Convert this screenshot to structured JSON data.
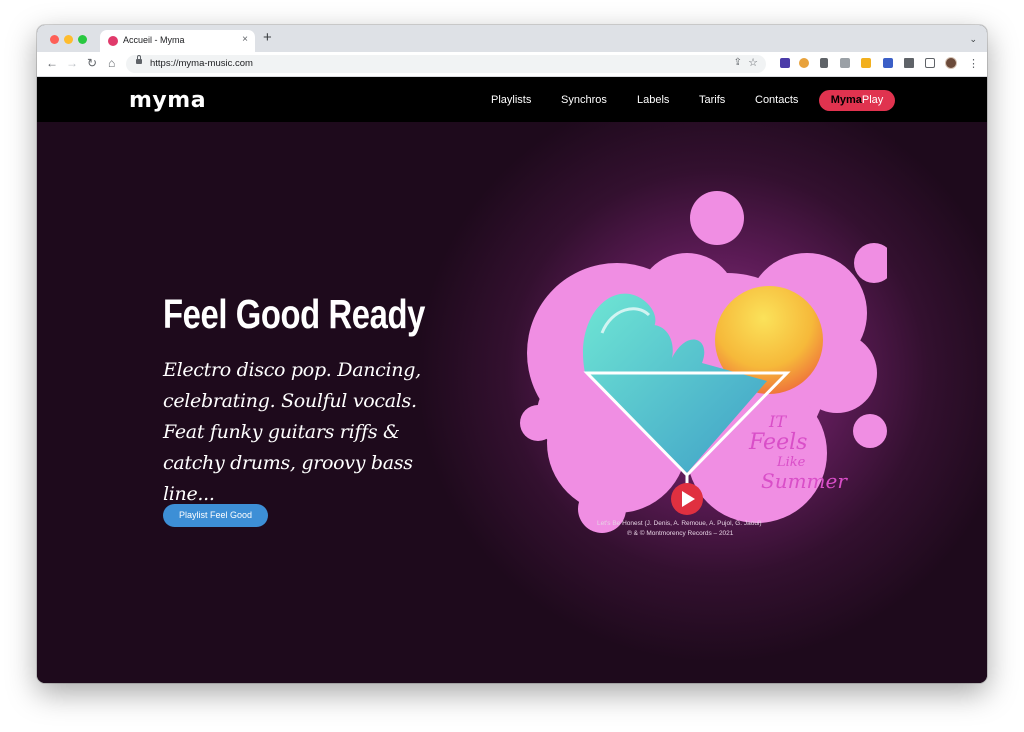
{
  "browser": {
    "tab_title": "Accueil - Myma",
    "tab_close": "×",
    "new_tab": "+",
    "tab_menu": "⌄",
    "url": "https://myma-music.com",
    "back": "←",
    "forward": "→",
    "reload": "↻",
    "home": "⌂",
    "share": "⇪",
    "star": "☆",
    "menu": "⋮"
  },
  "site": {
    "logo": "myma",
    "nav": [
      "Playlists",
      "Synchros",
      "Labels",
      "Tarifs",
      "Contacts"
    ],
    "cta_bold": "Myma",
    "cta_rest": "Play",
    "hero": {
      "title": "Feel Good Ready",
      "description": "Electro disco pop. Dancing, celebrating. Soulful vocals. Feat funky guitars riffs & catchy drums, groovy bass line...",
      "button": "Playlist Feel Good"
    },
    "artwork": {
      "handwriting": [
        "IT",
        "Feels",
        "Like",
        "Summer"
      ],
      "credit_line1": "Let's Be Honest (J. Denis, A. Remoue, A. Pujol, G. Jaoui)",
      "credit_line2": "℗ & © Montmorency Records – 2021"
    }
  },
  "colors": {
    "cta": "#e0334f",
    "button": "#3d8fd6",
    "blob": "#f08ee3",
    "sun": "#f6c63a",
    "wave": "#5fe0cf"
  }
}
